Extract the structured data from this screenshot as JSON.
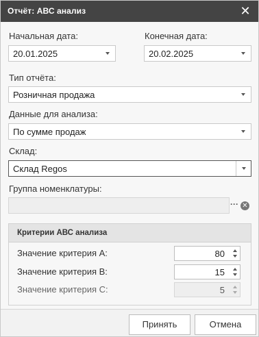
{
  "window": {
    "title": "Отчёт: АВС анализ",
    "close_glyph": "✕"
  },
  "fields": {
    "start_date": {
      "label": "Начальная дата:",
      "value": "20.01.2025"
    },
    "end_date": {
      "label": "Конечная дата:",
      "value": "20.02.2025"
    },
    "report_type": {
      "label": "Тип отчёта:",
      "value": "Розничная продажа"
    },
    "analysis_data": {
      "label": "Данные для анализа:",
      "value": "По сумме продаж"
    },
    "warehouse": {
      "label": "Склад:",
      "value": "Склад Regos"
    },
    "item_group": {
      "label": "Группа номенклатуры:",
      "value": "",
      "dots": "···",
      "clear_glyph": "✕"
    }
  },
  "criteria": {
    "title": "Критерии АВС анализа",
    "a": {
      "label": "Значение критерия А:",
      "value": "80"
    },
    "b": {
      "label": "Значение критерия В:",
      "value": "15"
    },
    "c": {
      "label": "Значение критерия С:",
      "value": "5"
    }
  },
  "buttons": {
    "accept": "Принять",
    "cancel": "Отмена"
  },
  "colors": {
    "titlebar": "#444444",
    "background": "#f7f7f7"
  }
}
